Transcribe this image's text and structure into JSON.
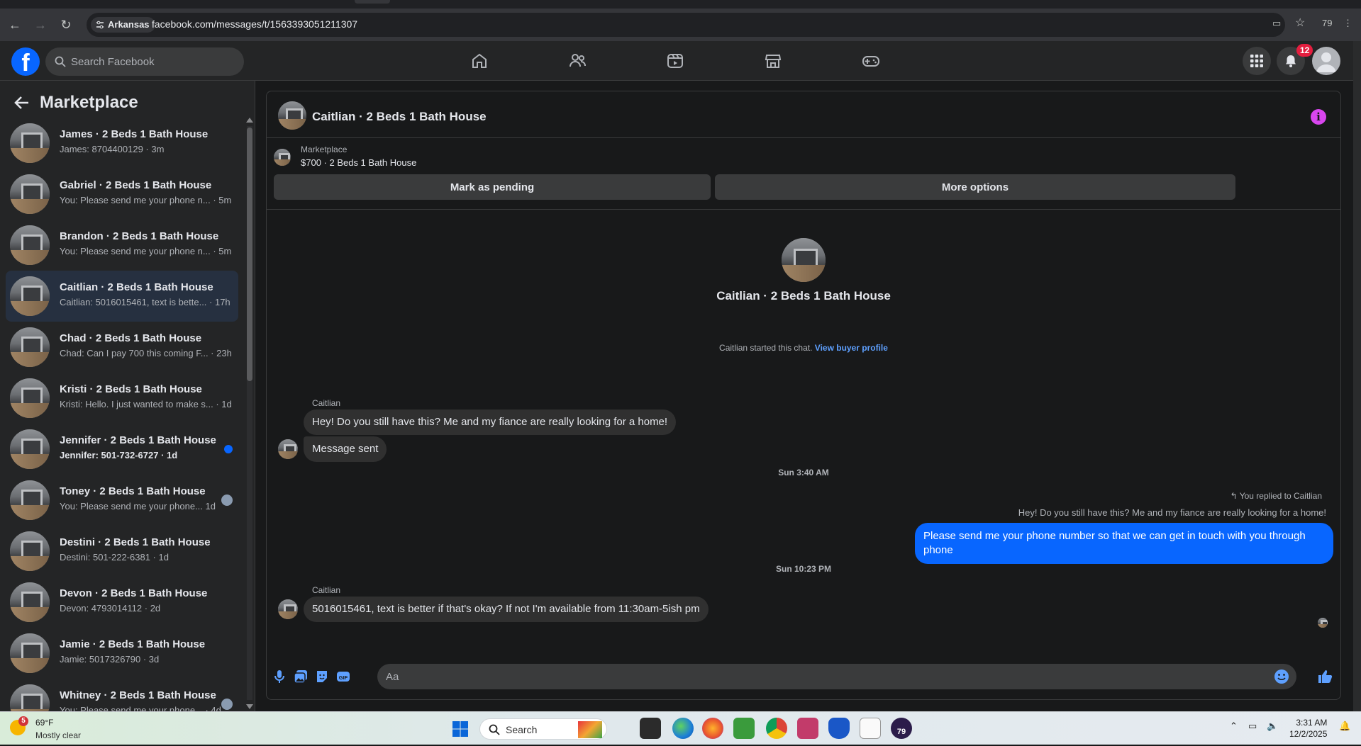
{
  "browser": {
    "location_chip": "Arkansas",
    "url": "facebook.com/messages/t/1563393051211307",
    "zoom_badge": "79"
  },
  "header": {
    "search_placeholder": "Search Facebook",
    "notification_count": "12",
    "nav_tabs": [
      "home-icon",
      "friends-icon",
      "video-icon",
      "marketplace-icon",
      "gaming-icon"
    ]
  },
  "sidebar": {
    "title": "Marketplace",
    "conversations": [
      {
        "name": "James · 2 Beds 1 Bath House",
        "preview": "James: 8704400129 · 3m",
        "unread": false
      },
      {
        "name": "Gabriel · 2 Beds 1 Bath House",
        "preview": "You: Please send me your phone n... · 5m",
        "unread": false
      },
      {
        "name": "Brandon · 2 Beds 1 Bath House",
        "preview": "You: Please send me your phone n... · 5m",
        "unread": false
      },
      {
        "name": "Caitlian · 2 Beds 1 Bath House",
        "preview": "Caitlian: 5016015461, text is bette... · 17h",
        "unread": false,
        "active": true
      },
      {
        "name": "Chad · 2 Beds 1 Bath House",
        "preview": "Chad: Can I pay 700 this coming F... · 23h",
        "unread": false
      },
      {
        "name": "Kristi · 2 Beds 1 Bath House",
        "preview": "Kristi: Hello. I just wanted to make s... · 1d",
        "unread": false
      },
      {
        "name": "Jennifer · 2 Beds 1 Bath House",
        "preview": "Jennifer: 501-732-6727 · 1d",
        "unread": true
      },
      {
        "name": "Toney · 2 Beds 1 Bath House",
        "preview": "You: Please send me your phone...   1d",
        "unread": false,
        "seen": true
      },
      {
        "name": "Destini · 2 Beds 1 Bath House",
        "preview": "Destini: 501-222-6381 · 1d",
        "unread": false
      },
      {
        "name": "Devon · 2 Beds 1 Bath House",
        "preview": "Devon: 4793014112 · 2d",
        "unread": false
      },
      {
        "name": "Jamie · 2 Beds 1 Bath House",
        "preview": "Jamie: 5017326790 · 3d",
        "unread": false
      },
      {
        "name": "Whitney · 2 Beds 1 Bath House",
        "preview": "You: Please send me your phone... · 4d",
        "unread": false,
        "seen": true
      }
    ]
  },
  "chat": {
    "title": "Caitlian · 2 Beds 1 Bath House",
    "marketplace_label": "Marketplace",
    "listing": "$700 · 2 Beds 1 Bath House",
    "mark_pending": "Mark as pending",
    "more_options": "More options",
    "intro_title": "Caitlian · 2 Beds 1 Bath House",
    "started_text": "Caitlian started this chat.",
    "view_profile": "View buyer profile",
    "sender1": "Caitlian",
    "msg1": "Hey! Do you still have this? Me and my fiance are really looking for a home!",
    "msg2": "Message sent",
    "time1": "Sun 3:40 AM",
    "reply_note": "You replied to Caitlian",
    "quoted": "Hey! Do you still have this? Me and my fiance are really looking for a home!",
    "msg_out": "Please send me your phone  number so that we can get in touch with you through phone",
    "time2": "Sun 10:23 PM",
    "sender2": "Caitlian",
    "msg3": "5016015461, text is better if that's okay? If not I'm available from 11:30am-5ish pm",
    "composer_placeholder": "Aa"
  },
  "taskbar": {
    "weather_badge": "5",
    "temp": "69°F",
    "condition": "Mostly clear",
    "search_label": "Search",
    "time": "3:31 AM",
    "date": "12/2/2025",
    "app_badge": "79"
  }
}
